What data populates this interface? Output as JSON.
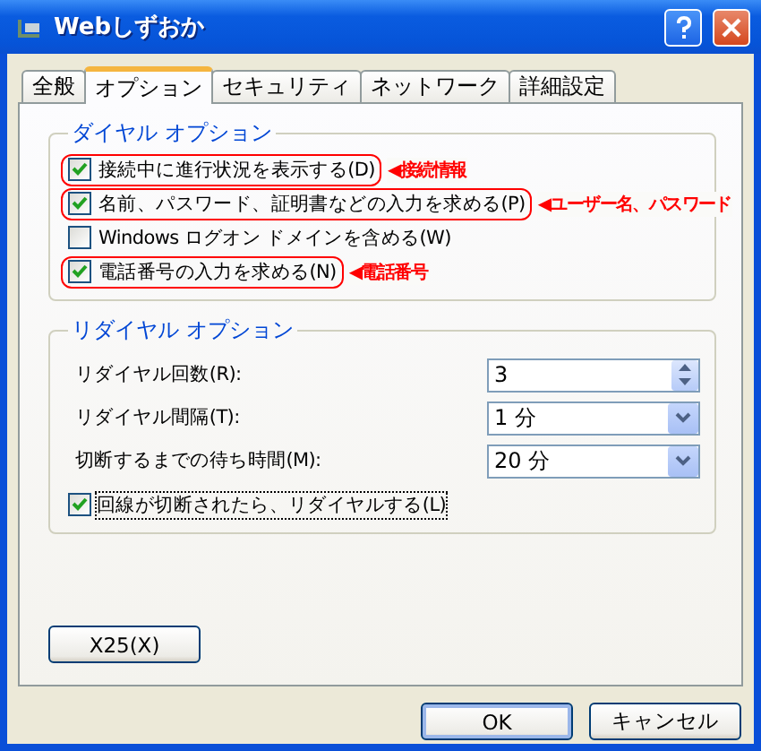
{
  "window": {
    "title": "Webしずおか"
  },
  "tabs": [
    {
      "label": "全般",
      "selected": false
    },
    {
      "label": "オプション",
      "selected": true
    },
    {
      "label": "セキュリティ",
      "selected": false
    },
    {
      "label": "ネットワーク",
      "selected": false
    },
    {
      "label": "詳細設定",
      "selected": false
    }
  ],
  "dial_options": {
    "title": "ダイヤル オプション",
    "items": [
      {
        "label": "接続中に進行状況を表示する(D)",
        "checked": true,
        "highlighted": true,
        "annotation": "◀接続情報"
      },
      {
        "label": "名前、パスワード、証明書などの入力を求める(P)",
        "checked": true,
        "highlighted": true,
        "annotation": "◀ユーザー名、パスワード"
      },
      {
        "label": "Windows ログオン ドメインを含める(W)",
        "checked": false,
        "highlighted": false
      },
      {
        "label": "電話番号の入力を求める(N)",
        "checked": true,
        "highlighted": true,
        "annotation": "◀電話番号"
      }
    ]
  },
  "redial_options": {
    "title": "リダイヤル オプション",
    "fields": [
      {
        "label": "リダイヤル回数(R):",
        "kind": "spin",
        "value": "3"
      },
      {
        "label": "リダイヤル間隔(T):",
        "kind": "dropdown",
        "value": "1 分"
      },
      {
        "label": "切断するまでの待ち時間(M):",
        "kind": "dropdown",
        "value": "20 分"
      }
    ],
    "checkbox": {
      "label": "回線が切断されたら、リダイヤルする(L)",
      "checked": true,
      "focused": true
    }
  },
  "x25_button": "X25(X)",
  "buttons": [
    {
      "label": "OK",
      "default": true
    },
    {
      "label": "キャンセル",
      "default": false
    }
  ]
}
